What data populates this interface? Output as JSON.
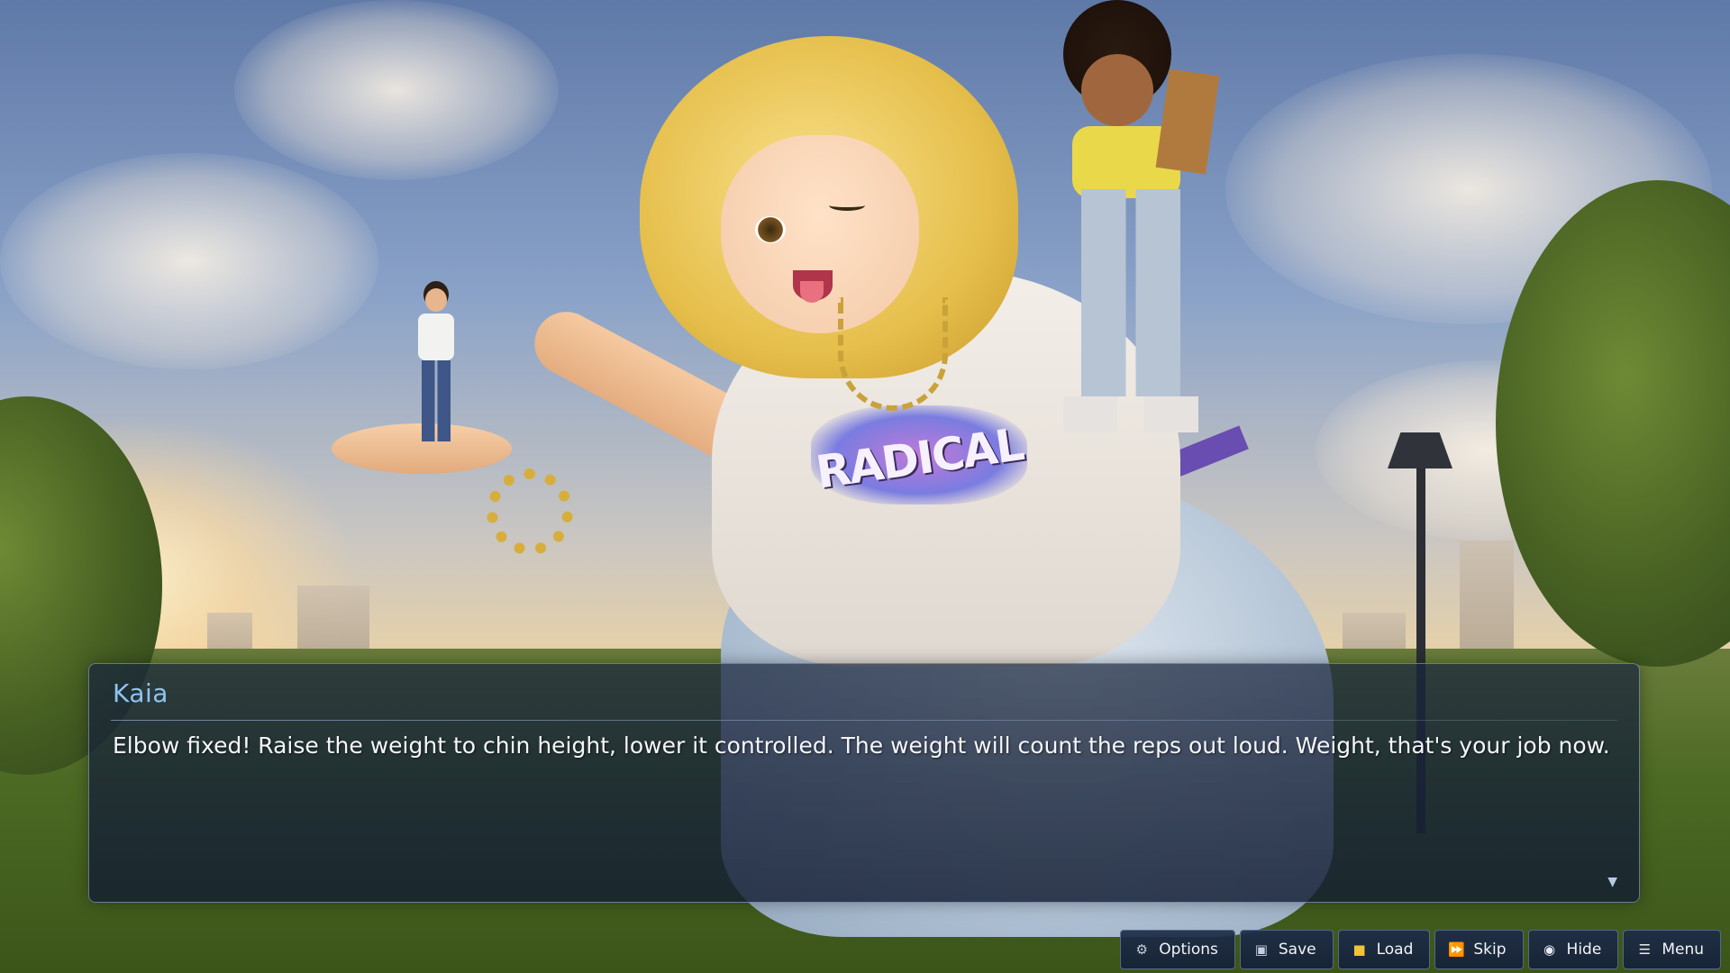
{
  "scene": {
    "shirt_print": "RADICAL"
  },
  "dialogue": {
    "speaker": "Kaia",
    "text": "Elbow fixed! Raise the weight to chin height, lower it controlled. The weight will count the reps out loud. Weight, that's your job now.",
    "advance_glyph": "▼",
    "name_color": "#8ec4f2"
  },
  "quick_menu": {
    "options": {
      "label": "Options",
      "icon": "gear-icon"
    },
    "save": {
      "label": "Save",
      "icon": "floppy-disk-icon"
    },
    "load": {
      "label": "Load",
      "icon": "folder-icon"
    },
    "skip": {
      "label": "Skip",
      "icon": "fast-forward-icon"
    },
    "hide": {
      "label": "Hide",
      "icon": "eye-icon"
    },
    "menu": {
      "label": "Menu",
      "icon": "hamburger-icon"
    }
  }
}
